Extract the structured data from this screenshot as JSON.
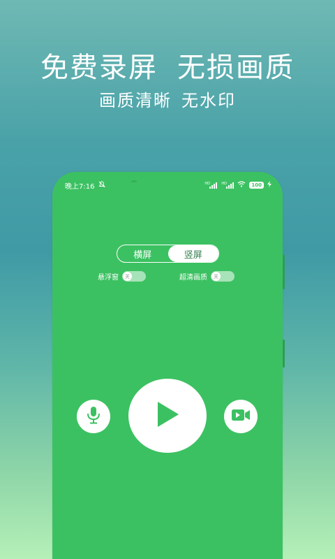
{
  "headline": {
    "left": "免费录屏",
    "right": "无损画质"
  },
  "subline": {
    "left": "画质清晰",
    "right": "无水印"
  },
  "status": {
    "time": "晚上7:16",
    "signal_tag": "HD",
    "battery": "100"
  },
  "orientation": {
    "options": [
      "横屏",
      "竖屏"
    ],
    "selected": "竖屏"
  },
  "toggles": [
    {
      "label": "悬浮窗",
      "state_label": "关",
      "on": false
    },
    {
      "label": "超清画质",
      "state_label": "关",
      "on": false
    }
  ],
  "controls": {
    "mic_icon": "microphone-icon",
    "play_icon": "play-icon",
    "camera_icon": "video-camera-icon"
  },
  "colors": {
    "accent": "#3cc162",
    "accent_dark": "#2f7d4b",
    "white": "#ffffff"
  }
}
